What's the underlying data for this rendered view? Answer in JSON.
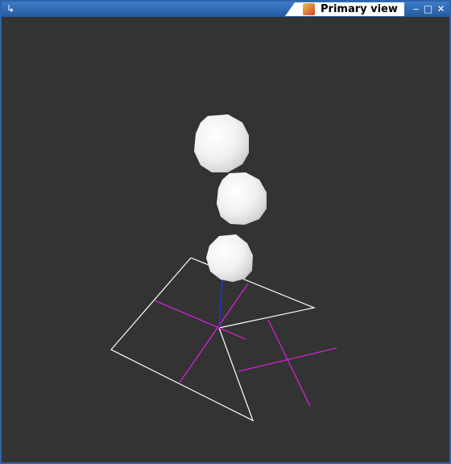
{
  "window": {
    "title": "Primary view",
    "controls": {
      "menu": "↳",
      "minimize": "‒",
      "maximize": "□",
      "close": "✕"
    }
  },
  "scene": {
    "background": "#333333",
    "sphere_color": "#f2f2f2",
    "sphere_count": 3,
    "frame_color": "#ffffff",
    "axes_color": "#cc22cc",
    "origin_line_color": "#2233cc"
  }
}
